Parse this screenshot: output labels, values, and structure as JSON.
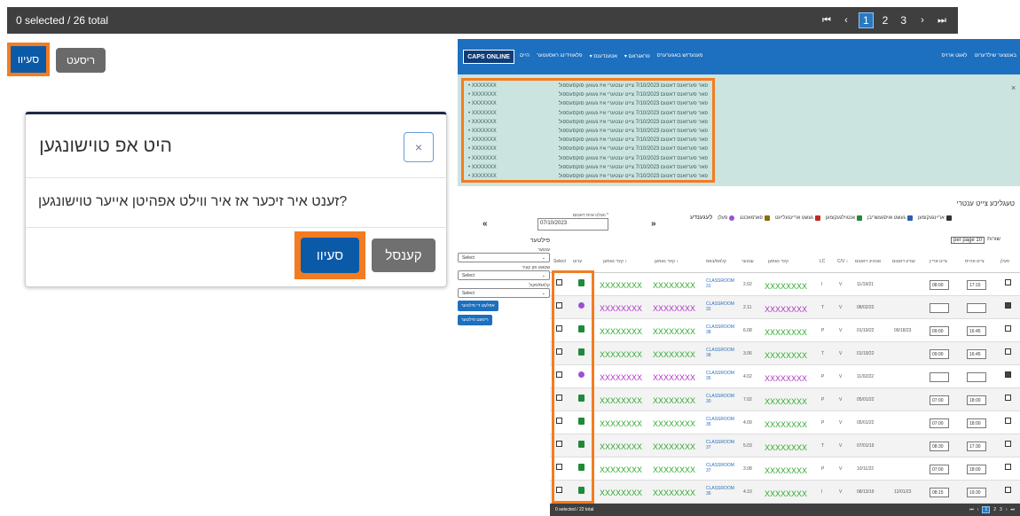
{
  "top_bar": {
    "count": "0 selected / 26 total",
    "pager": {
      "first": "⏮",
      "prev": "‹",
      "pages": [
        "1",
        "2",
        "3"
      ],
      "active_page": "1",
      "next": "›",
      "last": "⏭"
    }
  },
  "actions": {
    "save": "סעיוו",
    "reset": "ריסעט"
  },
  "modal": {
    "title": "היט אפ טוישונגען",
    "close": "×",
    "question": "?זענט איר זיכער אז איר ווילט אפהיטן אייער טוישונגען",
    "save": "סעיוו",
    "cancel": "קענסל"
  },
  "app": {
    "logo": "CAPS ONLINE",
    "menu": [
      "מענעדזש באגערערס",
      "פראגראם ▾",
      "אטענדענס ▾",
      "פלאווידינג ראסעטער",
      "היים"
    ],
    "user": [
      "באנוצער שילדערוט",
      "לאגט ארויס"
    ],
    "alert_lines": [
      {
        "text": "פאר פערזאנס דאטום 7/10/2023 צייט ענטערי איז געווען סוקסעספול",
        "name": "XXXXXXX"
      },
      {
        "text": "פאר פערזאנס דאטום 7/10/2023 צייט ענטערי איז געווען סוקסעספול",
        "name": "XXXXXXX"
      },
      {
        "text": "פאר פערזאנס דאטום 7/10/2023 צייט ענטערי איז געווען סוקסעספול",
        "name": "XXXXXXX"
      },
      {
        "text": "פאר פערזאנס דאטום 7/10/2023 צייט ענטערי איז געווען סוקסעספול",
        "name": "XXXXXXX"
      },
      {
        "text": "פאר פערזאנס דאטום 7/10/2023 צייט ענטערי איז געווען סוקסעספול",
        "name": "XXXXXXX"
      },
      {
        "text": "פאר פערזאנס דאטום 7/10/2023 צייט ענטערי איז געווען סוקסעספול",
        "name": "XXXXXXX"
      },
      {
        "text": "פאר פערזאנס דאטום 7/10/2023 צייט ענטערי איז געווען סוקסעספול",
        "name": "XXXXXXX"
      },
      {
        "text": "פאר פערזאנס דאטום 7/10/2023 צייט ענטערי איז געווען סוקסעספול",
        "name": "XXXXXXX"
      },
      {
        "text": "פאר פערזאנס דאטום 7/10/2023 צייט ענטערי איז געווען סוקסעספול",
        "name": "XXXXXXX"
      },
      {
        "text": "פאר פערזאנס דאטום 7/10/2023 צייט ענטערי איז געווען סוקסעספול",
        "name": "XXXXXXX"
      },
      {
        "text": "פאר פערזאנס דאטום 7/10/2023 צייט ענטערי איז געווען סוקסעספול",
        "name": "XXXXXXX"
      }
    ],
    "alert_close": "×",
    "page_title": "טעגליכע צייט ענטרי",
    "date_label": "* וועלט אויס דאטום",
    "date_value": "07/10/2023",
    "prev": "«",
    "next": "»",
    "legend": [
      "אריינגעקומען",
      "געשט אויסגעשריבן",
      "אנטוילגעקומען",
      "געשט אריינגעלייגט",
      "פארמאכונג",
      "פעלן",
      "לעגענדע"
    ],
    "legend_colors": [
      "#333333",
      "#2d5fa8",
      "#1f8a3a",
      "#c62828",
      "#8a6d00",
      "#9b4fd6",
      "#9b4fd6"
    ],
    "filters": {
      "title": "פילטער",
      "fields": [
        {
          "label": "ענטער",
          "value": "Select"
        },
        {
          "label": "שטאט פון קעיר",
          "value": "Select"
        },
        {
          "label": "קלאס/סקול",
          "value": "Select"
        }
      ],
      "apply": "אפּלעט די פילטער",
      "reset": "ריסעט פילטער"
    },
    "per_page_label": "שורות",
    "per_page_value": "10 per page",
    "headers": [
      "Select",
      "ערוט",
      "קינד נאמען ↕",
      "קינד נאמען ↕",
      "קלאס/באס",
      "ענטער",
      "קינד נאמען",
      "LC",
      "C/V ↕",
      "אנהויב דאטום",
      "ענדע דאטום",
      "צייט אריין",
      "צייט ארויס",
      "פעלן"
    ],
    "rows": [
      {
        "icon": "green",
        "name1": "XXXXXXXX",
        "name2": "XXXXXXXX",
        "cls": "CLASSROOM 31",
        "num": "2.02",
        "child": "XXXXXXXX",
        "lc": "I",
        "cv": "V",
        "start": "11/19/21",
        "end": "",
        "tin": "08:00",
        "tout": "17:15",
        "absent": false,
        "color": "#2eaa2e"
      },
      {
        "icon": "purple",
        "name1": "XXXXXXXX",
        "name2": "XXXXXXXX",
        "cls": "CLASSROOM 32",
        "num": "2.11",
        "child": "XXXXXXXX",
        "lc": "T",
        "cv": "V",
        "start": "08/02/22",
        "end": "",
        "tin": "",
        "tout": "",
        "absent": true,
        "color": "#b033c4"
      },
      {
        "icon": "green",
        "name1": "XXXXXXXX",
        "name2": "XXXXXXXX",
        "cls": "CLASSROOM 38",
        "num": "6.08",
        "child": "XXXXXXXX",
        "lc": "P",
        "cv": "V",
        "start": "01/19/22",
        "end": "09/18/23",
        "tin": "09:00",
        "tout": "16:45",
        "absent": false,
        "color": "#2eaa2e"
      },
      {
        "icon": "green",
        "name1": "XXXXXXXX",
        "name2": "XXXXXXXX",
        "cls": "CLASSROOM 38",
        "num": "3.06",
        "child": "XXXXXXXX",
        "lc": "T",
        "cv": "V",
        "start": "01/19/22",
        "end": "",
        "tin": "09:00",
        "tout": "16:45",
        "absent": false,
        "color": "#2eaa2e"
      },
      {
        "icon": "purple",
        "name1": "XXXXXXXX",
        "name2": "XXXXXXXX",
        "cls": "CLASSROOM 35",
        "num": "4.02",
        "child": "XXXXXXXX",
        "lc": "P",
        "cv": "V",
        "start": "11/02/22",
        "end": "",
        "tin": "",
        "tout": "",
        "absent": true,
        "color": "#b033c4"
      },
      {
        "icon": "green",
        "name1": "XXXXXXXX",
        "name2": "XXXXXXXX",
        "cls": "CLASSROOM 30",
        "num": "7.02",
        "child": "XXXXXXXX",
        "lc": "P",
        "cv": "V",
        "start": "05/01/22",
        "end": "",
        "tin": "07:00",
        "tout": "18:00",
        "absent": false,
        "color": "#2eaa2e"
      },
      {
        "icon": "green",
        "name1": "XXXXXXXX",
        "name2": "XXXXXXXX",
        "cls": "CLASSROOM 35",
        "num": "4.09",
        "child": "XXXXXXXX",
        "lc": "P",
        "cv": "V",
        "start": "05/01/22",
        "end": "",
        "tin": "07:00",
        "tout": "18:00",
        "absent": false,
        "color": "#2eaa2e"
      },
      {
        "icon": "green",
        "name1": "XXXXXXXX",
        "name2": "XXXXXXXX",
        "cls": "CLASSROOM 37",
        "num": "5.03",
        "child": "XXXXXXXX",
        "lc": "T",
        "cv": "V",
        "start": "07/01/19",
        "end": "",
        "tin": "08:30",
        "tout": "17:30",
        "absent": false,
        "color": "#2eaa2e"
      },
      {
        "icon": "green",
        "name1": "XXXXXXXX",
        "name2": "XXXXXXXX",
        "cls": "CLASSROOM 37",
        "num": "3.08",
        "child": "XXXXXXXX",
        "lc": "P",
        "cv": "V",
        "start": "10/11/22",
        "end": "",
        "tin": "07:00",
        "tout": "18:00",
        "absent": false,
        "color": "#2eaa2e"
      },
      {
        "icon": "green",
        "name1": "XXXXXXXX",
        "name2": "XXXXXXXX",
        "cls": "CLASSROOM 36",
        "num": "4.10",
        "child": "XXXXXXXX",
        "lc": "I",
        "cv": "V",
        "start": "08/13/19",
        "end": "12/01/23",
        "tin": "08:15",
        "tout": "19:30",
        "absent": false,
        "color": "#2eaa2e"
      }
    ],
    "bottom_count": "0 selected / 22 total",
    "bottom_pager": [
      "⏮",
      "‹",
      "1",
      "2",
      "3",
      "›",
      "⏭"
    ],
    "bottom_active": "1"
  }
}
